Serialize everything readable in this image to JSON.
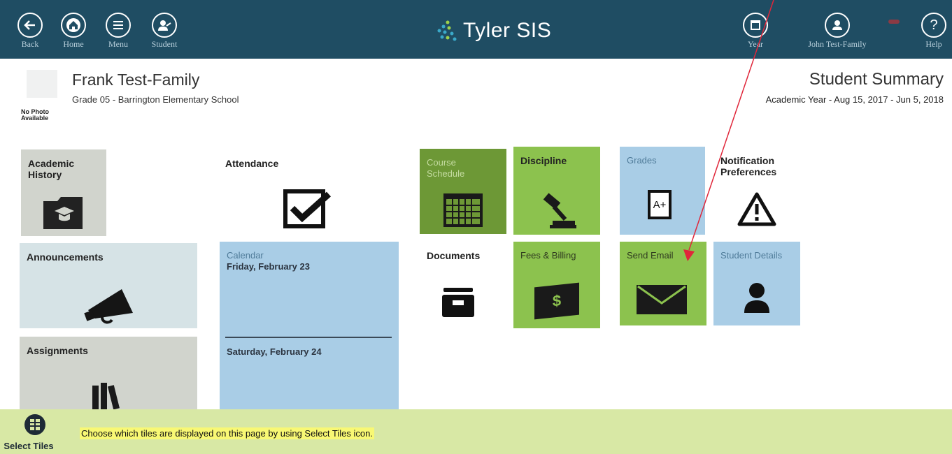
{
  "topbar": {
    "nav": [
      {
        "key": "back",
        "label": "Back"
      },
      {
        "key": "home",
        "label": "Home"
      },
      {
        "key": "menu",
        "label": "Menu"
      },
      {
        "key": "student",
        "label": "Student"
      }
    ],
    "brand": "Tyler SIS",
    "right": [
      {
        "key": "year",
        "label": "Year"
      },
      {
        "key": "user",
        "label": "John Test-Family"
      },
      {
        "key": "help",
        "label": "Help"
      }
    ],
    "bg_color": "#1f4d63"
  },
  "student": {
    "name": "Frank Test-Family",
    "grade": "Grade 05 - Barrington Elementary School",
    "photo_text_1": "No Photo",
    "photo_text_2": "Available"
  },
  "page": {
    "title": "Student Summary",
    "academic_year": "Academic Year - Aug 15, 2017 - Jun 5, 2018"
  },
  "tiles": {
    "academic_history": "Academic History",
    "attendance": "Attendance",
    "course_schedule": "Course Schedule",
    "discipline": "Discipline",
    "grades": "Grades",
    "grades_icon_text": "A+",
    "notification": "Notification Preferences",
    "announcements": "Announcements",
    "calendar": "Calendar",
    "calendar_day1": "Friday, February 23",
    "calendar_day2": "Saturday, February 24",
    "documents": "Documents",
    "fees": "Fees & Billing",
    "fees_icon_text": "$",
    "send_email": "Send Email",
    "student_details": "Student Details",
    "assignments": "Assignments"
  },
  "bottom": {
    "select_tiles": "Select Tiles",
    "hint": "Choose which tiles are displayed on this page by using Select Tiles icon."
  }
}
